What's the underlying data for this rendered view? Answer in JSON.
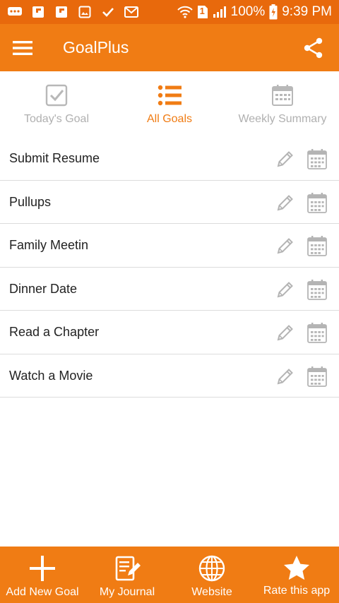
{
  "status_bar": {
    "notification_icons": [
      "chat-icon",
      "flipboard-icon",
      "flipboard-icon",
      "image-icon",
      "check-icon",
      "gmail-icon"
    ],
    "sim_label": "1",
    "battery_text": "100%",
    "time": "9:39 PM"
  },
  "app_bar": {
    "title": "GoalPlus"
  },
  "tabs": [
    {
      "label": "Today's Goal",
      "icon": "checkbox-icon",
      "active": false
    },
    {
      "label": "All Goals",
      "icon": "list-icon",
      "active": true
    },
    {
      "label": "Weekly Summary",
      "icon": "calendar-icon",
      "active": false
    }
  ],
  "goals": [
    {
      "name": "Submit Resume"
    },
    {
      "name": "Pullups"
    },
    {
      "name": "Family Meetin"
    },
    {
      "name": "Dinner Date"
    },
    {
      "name": "Read a Chapter"
    },
    {
      "name": "Watch a Movie"
    }
  ],
  "bottom_bar": [
    {
      "label": "Add New Goal",
      "icon": "plus-icon"
    },
    {
      "label": "My Journal",
      "icon": "journal-icon"
    },
    {
      "label": "Website",
      "icon": "globe-icon"
    },
    {
      "label": "Rate this app",
      "icon": "star-icon"
    }
  ],
  "colors": {
    "accent": "#f07c14",
    "status_bar": "#e8690c",
    "inactive_tab": "#b0b0b0",
    "divider": "#dcdcdc"
  }
}
